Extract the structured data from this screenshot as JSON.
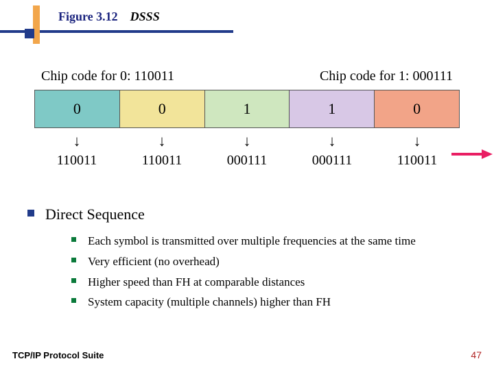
{
  "header": {
    "figure_label": "Figure 3.12",
    "title": "DSSS"
  },
  "figure": {
    "chip0_label": "Chip code for 0: 110011",
    "chip1_label": "Chip code for 1: 000111",
    "boxes": [
      {
        "bit": "0",
        "color": "teal"
      },
      {
        "bit": "0",
        "color": "yellow"
      },
      {
        "bit": "1",
        "color": "green"
      },
      {
        "bit": "1",
        "color": "purple"
      },
      {
        "bit": "0",
        "color": "orange"
      }
    ],
    "codes": [
      "110011",
      "110011",
      "000111",
      "000111",
      "110011"
    ],
    "arrow_glyph": "↓"
  },
  "content": {
    "heading": "Direct Sequence",
    "points": [
      "Each symbol is transmitted over multiple frequencies at the same time",
      "Very efficient (no overhead)",
      "Higher speed than FH at comparable distances",
      "System capacity (multiple channels) higher than FH"
    ]
  },
  "footer": {
    "left": "TCP/IP Protocol Suite",
    "page": "47"
  },
  "chart_data": {
    "type": "table",
    "title": "DSSS chip-code expansion",
    "chip_code_for_0": "110011",
    "chip_code_for_1": "000111",
    "input_bits": [
      0,
      0,
      1,
      1,
      0
    ],
    "output_chips": [
      "110011",
      "110011",
      "000111",
      "000111",
      "110011"
    ]
  }
}
